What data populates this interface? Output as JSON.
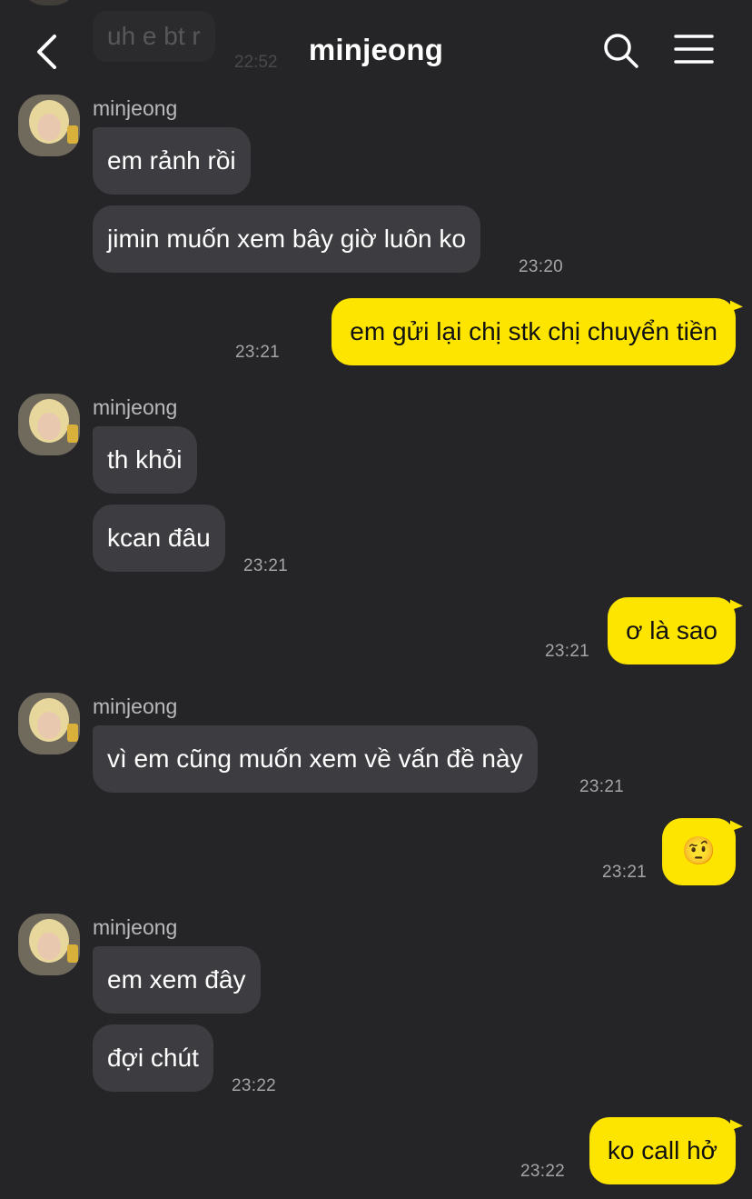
{
  "header": {
    "title": "minjeong"
  },
  "previous": {
    "text": "uh e bt r",
    "time": "22:52"
  },
  "groups": [
    {
      "sender": "minjeong",
      "messages": [
        "em rảnh rồi",
        "jimin muốn xem bây giờ luôn ko"
      ],
      "time": "23:20"
    },
    {
      "outgoing": "em gửi lại chị stk chị chuyển tiền",
      "time": "23:21"
    },
    {
      "sender": "minjeong",
      "messages": [
        "th khỏi",
        "kcan đâu"
      ],
      "time": "23:21"
    },
    {
      "outgoing": "ơ là sao",
      "time": "23:21"
    },
    {
      "sender": "minjeong",
      "messages": [
        "vì em cũng muốn xem về vấn đề này"
      ],
      "time": "23:21"
    },
    {
      "outgoing": "🤨",
      "time": "23:21"
    },
    {
      "sender": "minjeong",
      "messages": [
        "em xem đây",
        "đợi chút"
      ],
      "time": "23:22"
    },
    {
      "outgoing": "ko call hở",
      "time": "23:22"
    }
  ],
  "icons": {
    "back": "chevron-left-icon",
    "search": "search-icon",
    "menu": "menu-icon",
    "avatar": "avatar"
  },
  "colors": {
    "background": "#252528",
    "incoming_bubble": "#3d3d41",
    "outgoing_bubble": "#fee500",
    "timestamp": "#a5a5a8"
  }
}
